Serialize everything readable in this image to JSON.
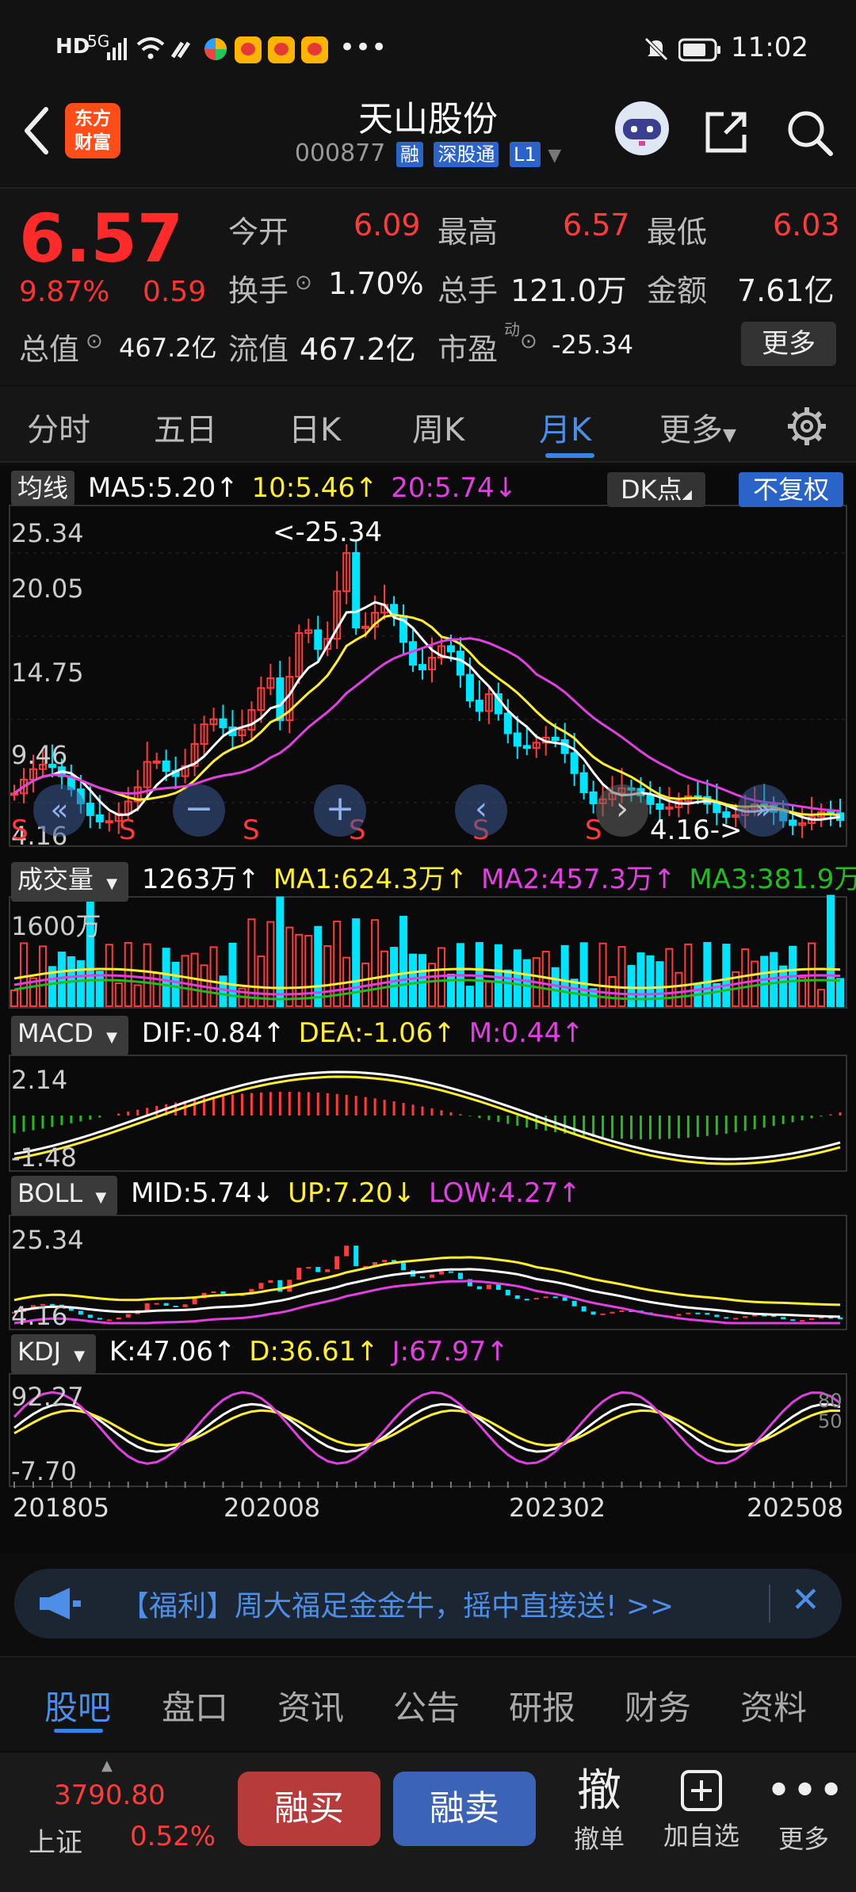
{
  "status_bar": {
    "left_icons": [
      "HD",
      "5G",
      "signal-icon",
      "wifi-icon",
      "nfc-icon",
      "colorful-app-icon",
      "weibo-icon",
      "weibo-icon",
      "weibo-icon",
      "more-dots"
    ],
    "time": "11:02",
    "mute_icon": "bell-mute-icon",
    "battery_icon": "battery-icon"
  },
  "header": {
    "app_logo_line1": "东方",
    "app_logo_line2": "财富",
    "stock_name": "天山股份",
    "stock_code": "000877",
    "tags": [
      "融",
      "深股通",
      "L1"
    ]
  },
  "quote": {
    "price": "6.57",
    "change_pct": "9.87%",
    "change": "0.59",
    "fields": [
      {
        "label": "今开",
        "value": "6.09",
        "color": "red"
      },
      {
        "label": "最高",
        "value": "6.57",
        "color": "red"
      },
      {
        "label": "最低",
        "value": "6.03",
        "color": "red"
      },
      {
        "label": "换手",
        "value": "1.70%",
        "color": "white"
      },
      {
        "label": "总手",
        "value": "121.0万",
        "color": "white"
      },
      {
        "label": "金额",
        "value": "7.61亿",
        "color": "white"
      },
      {
        "label": "总值",
        "value": "467.2亿",
        "color": "white"
      },
      {
        "label": "流值",
        "value": "467.2亿",
        "color": "white"
      },
      {
        "label": "市盈",
        "value": "-25.34",
        "color": "white"
      }
    ],
    "pe_superscript": "动",
    "more_label": "更多"
  },
  "period_tabs": [
    "分时",
    "五日",
    "日K",
    "周K",
    "月K",
    "更多"
  ],
  "active_period": "月K",
  "chart": {
    "ma_row": {
      "label": "均线",
      "ma5": "MA5:5.20",
      "ma10": "10:5.46",
      "ma20": "20:5.74",
      "dk": "DK点",
      "fq": "不复权"
    },
    "price_axis": [
      "25.34",
      "20.05",
      "14.75",
      "9.46",
      "4.16"
    ],
    "max_note": "<-25.34",
    "min_note": "4.16->",
    "s_markers": [
      "S",
      "S",
      "S",
      "S",
      "S",
      "S"
    ],
    "vol_row": {
      "label": "成交量",
      "vol": "1263万",
      "ma1": "MA1:624.3万",
      "ma2": "MA2:457.3万",
      "ma3": "MA3:381.9万"
    },
    "vol_axis": "1600万",
    "macd_row": {
      "label": "MACD",
      "dif": "DIF:-0.84",
      "dea": "DEA:-1.06",
      "m": "M:0.44"
    },
    "macd_axis": [
      "2.14",
      "-1.48"
    ],
    "boll_row": {
      "label": "BOLL",
      "mid": "MID:5.74",
      "up": "UP:7.20",
      "low": "LOW:4.27"
    },
    "boll_axis": [
      "25.34",
      "4.16"
    ],
    "kdj_row": {
      "label": "KDJ",
      "k": "K:47.06",
      "d": "D:36.61",
      "j": "J:67.97"
    },
    "kdj_axis": [
      "92.27",
      "-7.70"
    ],
    "kdj_right": [
      "80",
      "50"
    ],
    "x_axis": [
      "201805",
      "202008",
      "202302",
      "202508"
    ]
  },
  "banner": {
    "text": "【福利】周大福足金金牛，摇中直接送! >>"
  },
  "bottom_tabs": [
    "股吧",
    "盘口",
    "资讯",
    "公告",
    "研报",
    "财务",
    "资料"
  ],
  "active_bottom_tab": "股吧",
  "action_bar": {
    "index_value": "3790.80",
    "index_name": "上证",
    "index_pct": "0.52%",
    "buy": "融买",
    "sell": "融卖",
    "cancel_icon": "撤",
    "cancel_label": "撤单",
    "add_label": "加自选",
    "more_label": "更多"
  },
  "colors": {
    "up": "#ff3b3b",
    "down": "#00e5ff",
    "accent": "#3b82e8",
    "ma5": "#ffffff",
    "ma10": "#ffee33",
    "ma20": "#e040e0",
    "ma3": "#22bb22"
  },
  "chart_data": {
    "type": "candlestick",
    "title": "",
    "x": [
      "201805",
      "202008",
      "202302",
      "202508"
    ],
    "price_ylim": [
      4.16,
      25.34
    ],
    "series": [
      {
        "name": "MA5",
        "value": 5.2
      },
      {
        "name": "10",
        "value": 5.46
      },
      {
        "name": "20",
        "value": 5.74
      }
    ],
    "volume": {
      "value": "1263万",
      "ylim_top": "1600万"
    },
    "macd": {
      "dif": -0.84,
      "dea": -1.06,
      "m": 0.44,
      "ylim": [
        -1.48,
        2.14
      ]
    },
    "boll": {
      "mid": 5.74,
      "up": 7.2,
      "low": 4.27,
      "ylim": [
        4.16,
        25.34
      ]
    },
    "kdj": {
      "k": 47.06,
      "d": 36.61,
      "j": 67.97,
      "ylim": [
        -7.7,
        92.27
      ]
    }
  }
}
